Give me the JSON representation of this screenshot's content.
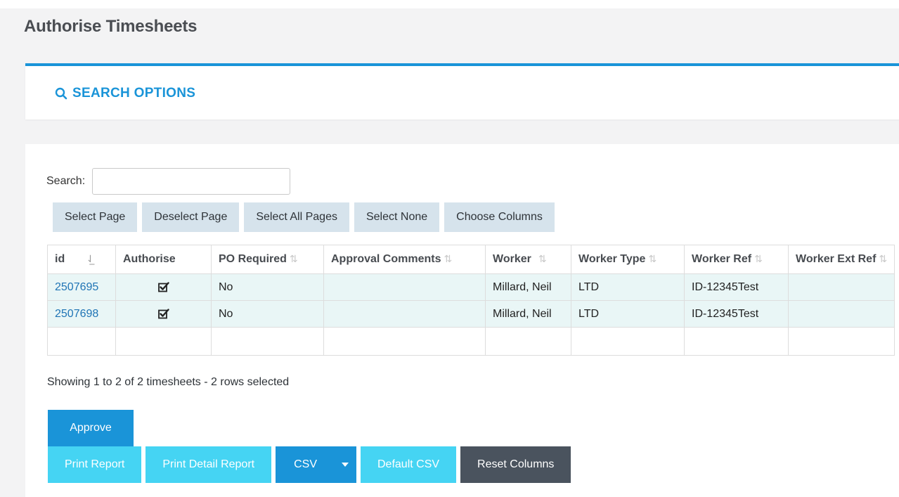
{
  "page": {
    "title": "Authorise Timesheets"
  },
  "search_options": {
    "label": "SEARCH OPTIONS"
  },
  "filter": {
    "label": "Search:",
    "value": "",
    "placeholder": ""
  },
  "selection_buttons": {
    "select_page": "Select Page",
    "deselect_page": "Deselect Page",
    "select_all_pages": "Select All Pages",
    "select_none": "Select None",
    "choose_columns": "Choose Columns"
  },
  "table": {
    "columns": [
      "id",
      "Authorise",
      "PO Required",
      "Approval Comments",
      "Worker",
      "Worker Type",
      "Worker Ref",
      "Worker Ext Ref"
    ],
    "rows": [
      {
        "id": "2507695",
        "authorise": true,
        "po_required": "No",
        "approval_comments": "",
        "worker": "Millard, Neil",
        "worker_type": "LTD",
        "worker_ref": "ID-12345Test",
        "worker_ext_ref": ""
      },
      {
        "id": "2507698",
        "authorise": true,
        "po_required": "No",
        "approval_comments": "",
        "worker": "Millard, Neil",
        "worker_type": "LTD",
        "worker_ref": "ID-12345Test",
        "worker_ext_ref": ""
      }
    ]
  },
  "status": {
    "showing": "Showing 1 to 2 of 2 timesheets - 2 rows selected"
  },
  "actions": {
    "approve": "Approve",
    "print_report": "Print Report",
    "print_detail_report": "Print Detail Report",
    "csv": "CSV",
    "default_csv": "Default CSV",
    "reset_columns": "Reset Columns"
  },
  "colors": {
    "accent": "#1a94d8",
    "light_accent": "#45d4f3",
    "dark_button": "#4a535e",
    "row_highlight": "#e9f6f6",
    "select_button_bg": "#d6e3ec"
  },
  "icons": {
    "search_options": "search-icon",
    "sort": "sort-icon",
    "authorise": "checkbox-checked-icon",
    "csv_dropdown": "caret-down-icon"
  }
}
